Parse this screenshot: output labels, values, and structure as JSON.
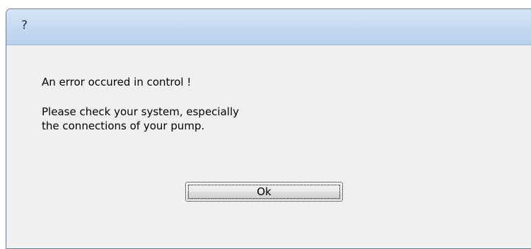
{
  "window": {
    "title": "?"
  },
  "message": {
    "line1": "An error occured in control !",
    "line2": "Please check your system, especially",
    "line3": "the connections of your pump."
  },
  "buttons": {
    "ok_label": "Ok"
  }
}
